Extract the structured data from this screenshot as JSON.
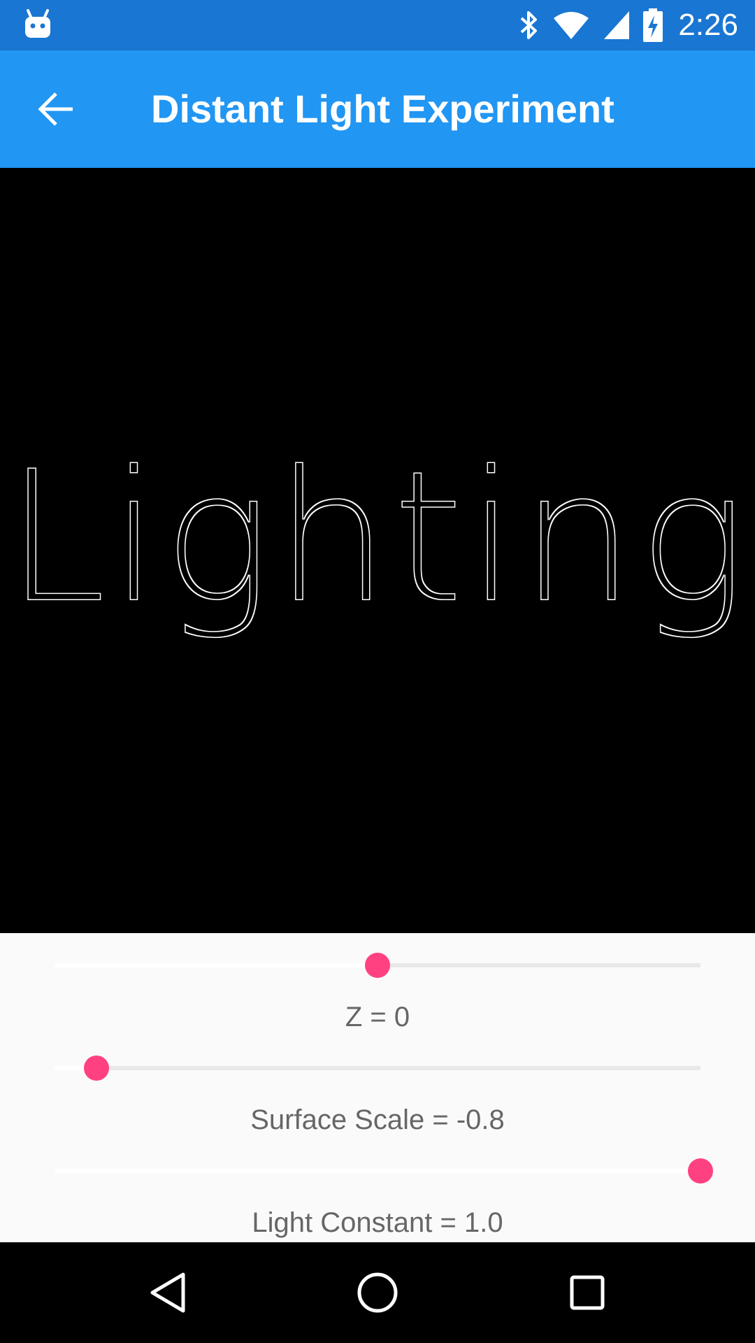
{
  "status_bar": {
    "time": "2:26",
    "icons": [
      "android-debug-icon",
      "bluetooth-icon",
      "wifi-icon",
      "cell-signal-icon",
      "battery-charging-icon"
    ],
    "background_color": "#1976d2"
  },
  "app_bar": {
    "title": "Distant Light Experiment",
    "back_icon": "arrow-back-icon",
    "background_color": "#2196f3"
  },
  "canvas": {
    "text": "Lighting",
    "background_color": "#000000",
    "stroke_color": "#ffffff"
  },
  "sliders": [
    {
      "label": "Z = 0",
      "value_fraction": 0.5
    },
    {
      "label": "Surface Scale = -0.8",
      "value_fraction": 0.065
    },
    {
      "label": "Light Constant = 1.0",
      "value_fraction": 1.0
    }
  ],
  "accent_color": "#ff4081",
  "nav_bar": {
    "buttons": [
      "back-triangle-icon",
      "home-circle-icon",
      "recents-square-icon"
    ]
  }
}
